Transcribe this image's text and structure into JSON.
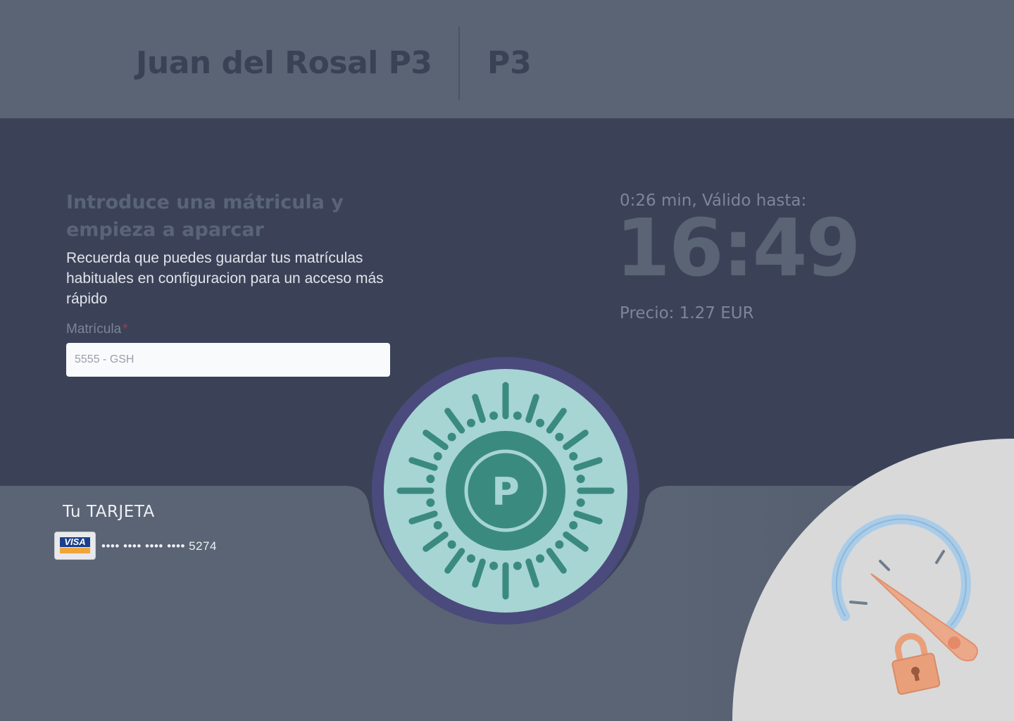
{
  "header": {
    "title": "Juan del Rosal P3",
    "code": "P3"
  },
  "intro": {
    "title": "Introduce una mátricula y empieza a aparcar",
    "text": "Recuerda que puedes guardar tus matrículas habituales en configuracion para un acceso más rápido"
  },
  "form": {
    "plate_label": "Matrícula",
    "required_mark": "*",
    "plate_placeholder": "5555 - GSH",
    "plate_value": ""
  },
  "timer": {
    "label": "0:26 min, Válido hasta:",
    "time": "16:49",
    "price": "Precio: 1.27 EUR"
  },
  "park_button": {
    "letter": "P",
    "icon": "parking-icon"
  },
  "card": {
    "title": "Tu TARJETA",
    "brand": "VISA",
    "masked_number": "•••• •••• •••• •••• 5274"
  },
  "illustration": {
    "icons": [
      "speedometer-icon",
      "padlock-icon"
    ]
  },
  "colors": {
    "header_bg": "#5a6474",
    "main_bg": "#3b4258",
    "panel_bg": "#5a6474",
    "button_ring": "#4b4a7c",
    "button_face": "#a6d5d4",
    "button_accent": "#3b8a80",
    "lock_color": "#e9a07a",
    "gauge_color": "#a9cce8"
  }
}
